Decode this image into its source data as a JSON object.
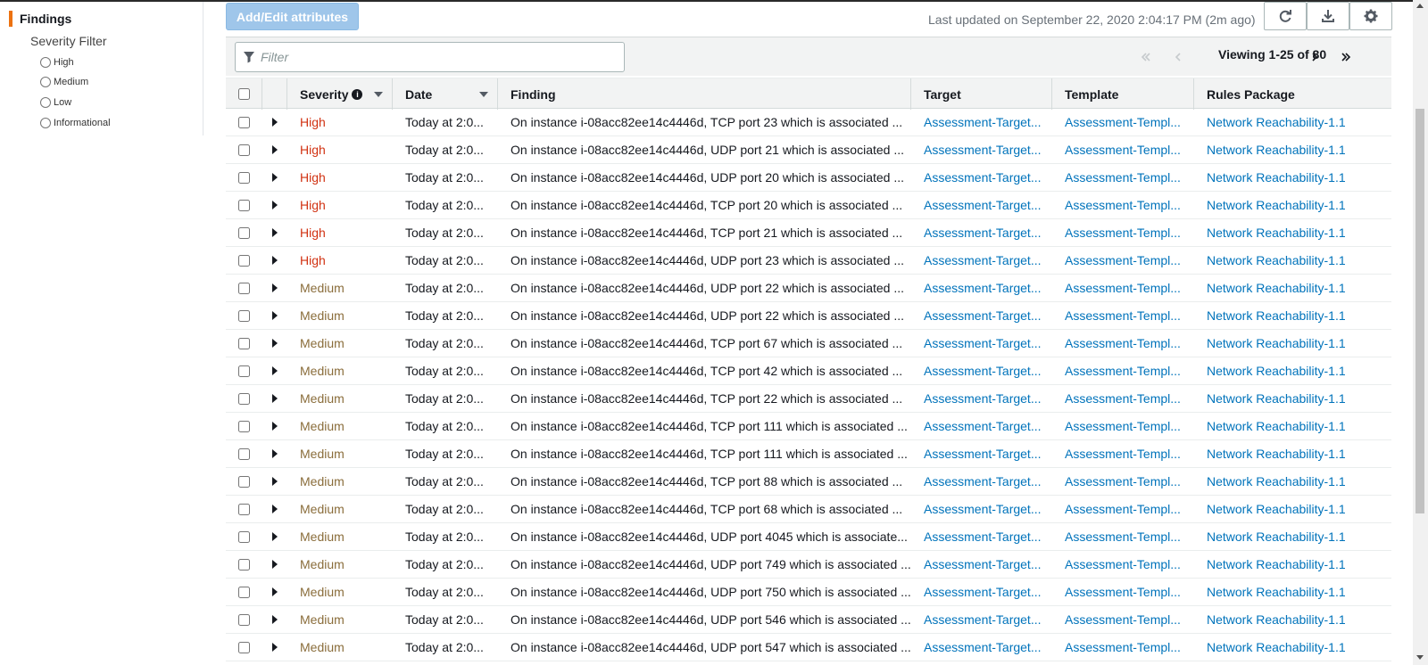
{
  "sidebar": {
    "title": "Findings",
    "filter_title": "Severity Filter",
    "options": [
      "High",
      "Medium",
      "Low",
      "Informational"
    ]
  },
  "toolbar": {
    "add_edit_label": "Add/Edit attributes",
    "last_updated": "Last updated on September 22, 2020 2:04:17 PM (2m ago)",
    "refresh_icon": "refresh-icon",
    "download_icon": "download-icon",
    "settings_icon": "gear-icon"
  },
  "filter": {
    "placeholder": "Filter"
  },
  "pagination": {
    "viewing": "Viewing 1-25 of 80"
  },
  "table": {
    "headers": {
      "severity": "Severity",
      "date": "Date",
      "finding": "Finding",
      "target": "Target",
      "template": "Template",
      "rules": "Rules Package"
    },
    "rows": [
      {
        "severity": "High",
        "date": "Today at 2:0...",
        "finding": "On instance i-08acc82ee14c4446d, TCP port 23 which is associated ...",
        "target": "Assessment-Target...",
        "template": "Assessment-Templ...",
        "rules": "Network Reachability-1.1"
      },
      {
        "severity": "High",
        "date": "Today at 2:0...",
        "finding": "On instance i-08acc82ee14c4446d, UDP port 21 which is associated ...",
        "target": "Assessment-Target...",
        "template": "Assessment-Templ...",
        "rules": "Network Reachability-1.1"
      },
      {
        "severity": "High",
        "date": "Today at 2:0...",
        "finding": "On instance i-08acc82ee14c4446d, UDP port 20 which is associated ...",
        "target": "Assessment-Target...",
        "template": "Assessment-Templ...",
        "rules": "Network Reachability-1.1"
      },
      {
        "severity": "High",
        "date": "Today at 2:0...",
        "finding": "On instance i-08acc82ee14c4446d, TCP port 20 which is associated ...",
        "target": "Assessment-Target...",
        "template": "Assessment-Templ...",
        "rules": "Network Reachability-1.1"
      },
      {
        "severity": "High",
        "date": "Today at 2:0...",
        "finding": "On instance i-08acc82ee14c4446d, TCP port 21 which is associated ...",
        "target": "Assessment-Target...",
        "template": "Assessment-Templ...",
        "rules": "Network Reachability-1.1"
      },
      {
        "severity": "High",
        "date": "Today at 2:0...",
        "finding": "On instance i-08acc82ee14c4446d, UDP port 23 which is associated ...",
        "target": "Assessment-Target...",
        "template": "Assessment-Templ...",
        "rules": "Network Reachability-1.1"
      },
      {
        "severity": "Medium",
        "date": "Today at 2:0...",
        "finding": "On instance i-08acc82ee14c4446d, UDP port 22 which is associated ...",
        "target": "Assessment-Target...",
        "template": "Assessment-Templ...",
        "rules": "Network Reachability-1.1"
      },
      {
        "severity": "Medium",
        "date": "Today at 2:0...",
        "finding": "On instance i-08acc82ee14c4446d, UDP port 22 which is associated ...",
        "target": "Assessment-Target...",
        "template": "Assessment-Templ...",
        "rules": "Network Reachability-1.1"
      },
      {
        "severity": "Medium",
        "date": "Today at 2:0...",
        "finding": "On instance i-08acc82ee14c4446d, TCP port 67 which is associated ...",
        "target": "Assessment-Target...",
        "template": "Assessment-Templ...",
        "rules": "Network Reachability-1.1"
      },
      {
        "severity": "Medium",
        "date": "Today at 2:0...",
        "finding": "On instance i-08acc82ee14c4446d, TCP port 42 which is associated ...",
        "target": "Assessment-Target...",
        "template": "Assessment-Templ...",
        "rules": "Network Reachability-1.1"
      },
      {
        "severity": "Medium",
        "date": "Today at 2:0...",
        "finding": "On instance i-08acc82ee14c4446d, TCP port 22 which is associated ...",
        "target": "Assessment-Target...",
        "template": "Assessment-Templ...",
        "rules": "Network Reachability-1.1"
      },
      {
        "severity": "Medium",
        "date": "Today at 2:0...",
        "finding": "On instance i-08acc82ee14c4446d, TCP port 111 which is associated ...",
        "target": "Assessment-Target...",
        "template": "Assessment-Templ...",
        "rules": "Network Reachability-1.1"
      },
      {
        "severity": "Medium",
        "date": "Today at 2:0...",
        "finding": "On instance i-08acc82ee14c4446d, TCP port 111 which is associated ...",
        "target": "Assessment-Target...",
        "template": "Assessment-Templ...",
        "rules": "Network Reachability-1.1"
      },
      {
        "severity": "Medium",
        "date": "Today at 2:0...",
        "finding": "On instance i-08acc82ee14c4446d, TCP port 88 which is associated ...",
        "target": "Assessment-Target...",
        "template": "Assessment-Templ...",
        "rules": "Network Reachability-1.1"
      },
      {
        "severity": "Medium",
        "date": "Today at 2:0...",
        "finding": "On instance i-08acc82ee14c4446d, TCP port 68 which is associated ...",
        "target": "Assessment-Target...",
        "template": "Assessment-Templ...",
        "rules": "Network Reachability-1.1"
      },
      {
        "severity": "Medium",
        "date": "Today at 2:0...",
        "finding": "On instance i-08acc82ee14c4446d, UDP port 4045 which is associate...",
        "target": "Assessment-Target...",
        "template": "Assessment-Templ...",
        "rules": "Network Reachability-1.1"
      },
      {
        "severity": "Medium",
        "date": "Today at 2:0...",
        "finding": "On instance i-08acc82ee14c4446d, UDP port 749 which is associated ...",
        "target": "Assessment-Target...",
        "template": "Assessment-Templ...",
        "rules": "Network Reachability-1.1"
      },
      {
        "severity": "Medium",
        "date": "Today at 2:0...",
        "finding": "On instance i-08acc82ee14c4446d, UDP port 750 which is associated ...",
        "target": "Assessment-Target...",
        "template": "Assessment-Templ...",
        "rules": "Network Reachability-1.1"
      },
      {
        "severity": "Medium",
        "date": "Today at 2:0...",
        "finding": "On instance i-08acc82ee14c4446d, UDP port 546 which is associated ...",
        "target": "Assessment-Target...",
        "template": "Assessment-Templ...",
        "rules": "Network Reachability-1.1"
      },
      {
        "severity": "Medium",
        "date": "Today at 2:0...",
        "finding": "On instance i-08acc82ee14c4446d, UDP port 547 which is associated ...",
        "target": "Assessment-Target...",
        "template": "Assessment-Templ...",
        "rules": "Network Reachability-1.1"
      }
    ]
  },
  "colors": {
    "high": "#d13212",
    "medium": "#8a6d3b",
    "link": "#0073bb",
    "accent": "#ec7211",
    "primary_disabled": "#9fc6ea"
  }
}
